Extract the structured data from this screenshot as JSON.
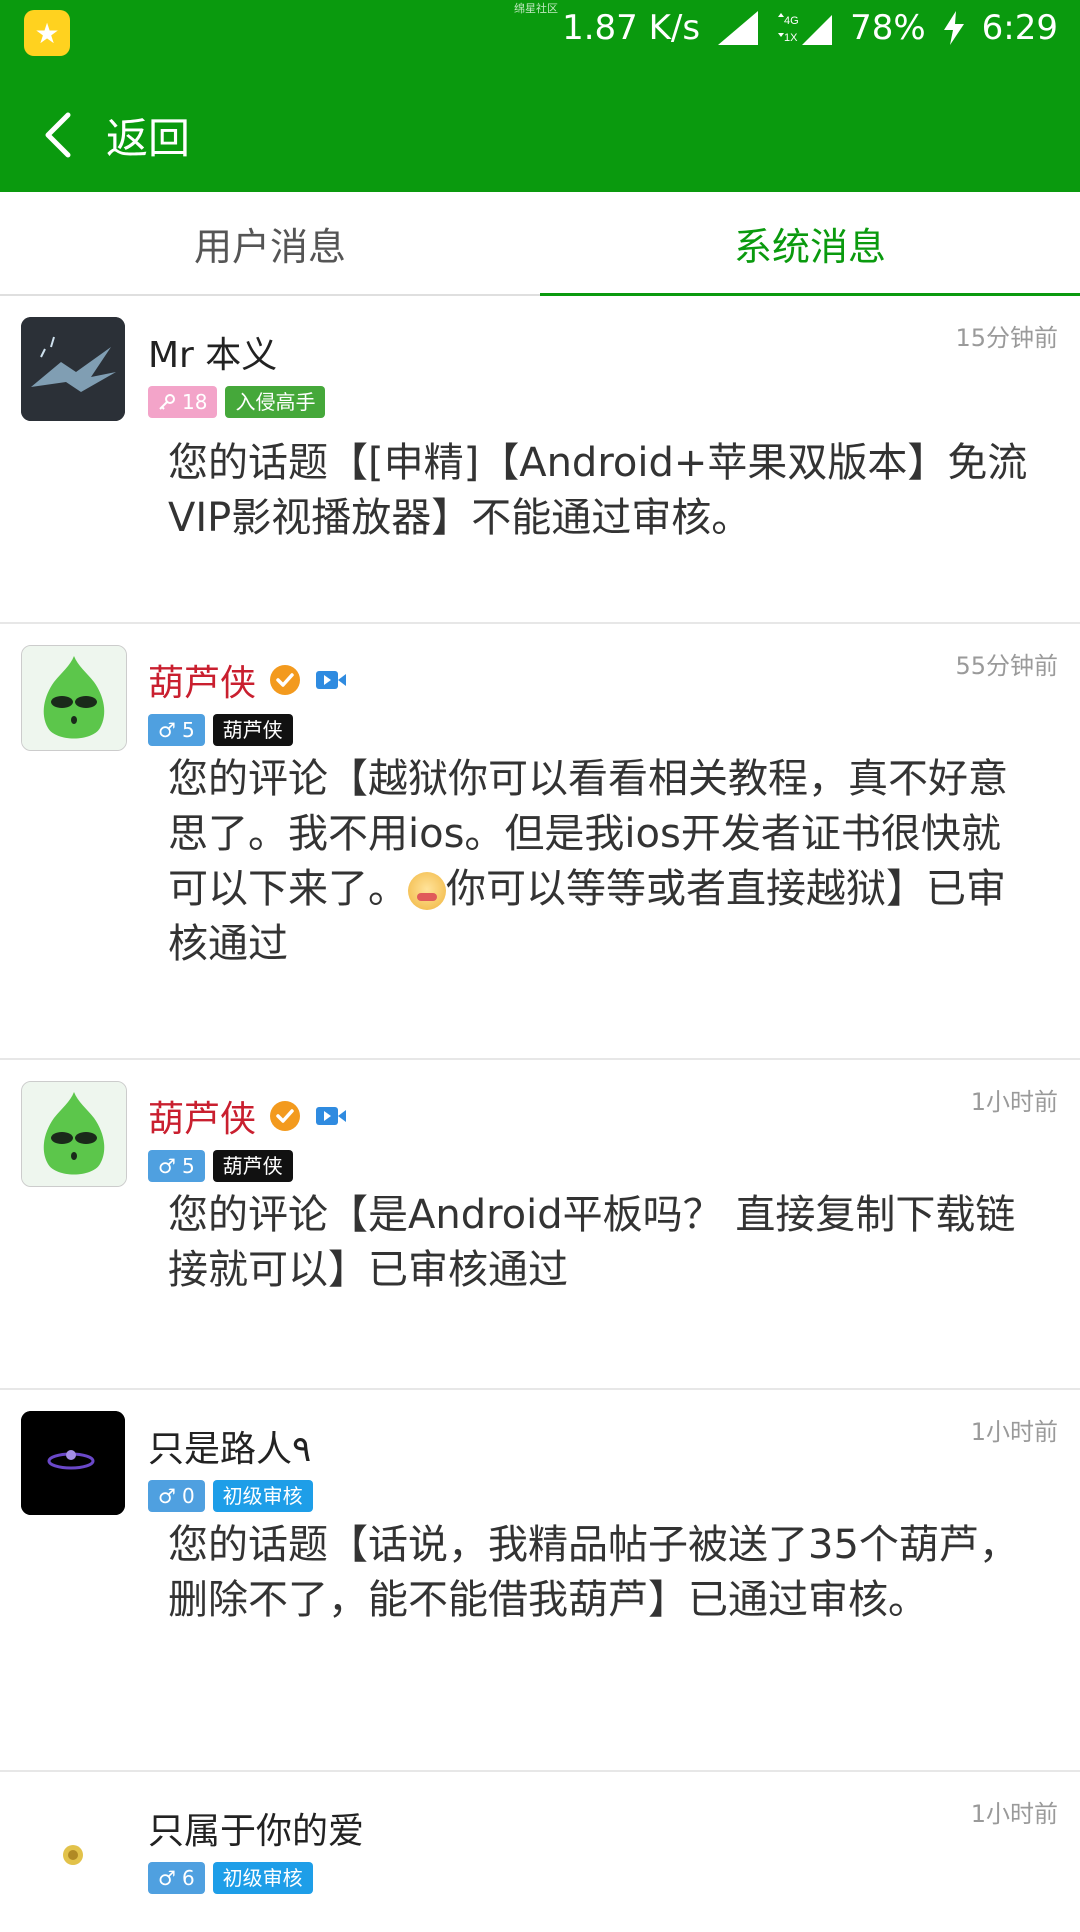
{
  "status": {
    "top_tiny_text": "绵星社区",
    "speed": "1.87 K/s",
    "network": "4G 1X",
    "battery": "78%",
    "time": "6:29"
  },
  "nav": {
    "back_label": "返回"
  },
  "tabs": [
    {
      "label": "用户消息",
      "active": false
    },
    {
      "label": "系统消息",
      "active": true
    }
  ],
  "colors": {
    "brand_green": "#0a9a0e",
    "username_red": "#c91f2f"
  },
  "messages": [
    {
      "username": "Mr 本义",
      "username_color": "normal",
      "time": "15分钟前",
      "badges": [
        {
          "text": "18",
          "kind": "key-pink"
        },
        {
          "text": "入侵高手",
          "kind": "green"
        }
      ],
      "content": "您的话题【[申精]【Android+苹果双版本】免流VIP影视播放器】不能通过审核。"
    },
    {
      "username": "葫芦侠",
      "username_color": "red",
      "time": "55分钟前",
      "badges": [
        {
          "text": "5",
          "kind": "male-blue"
        },
        {
          "text": "葫芦侠",
          "kind": "black"
        }
      ],
      "content_before_emoji": "您的评论【越狱你可以看看相关教程，真不好意思了。我不用ios。但是我ios开发者证书很快就可以下来了。",
      "content_after_emoji": "你可以等等或者直接越狱】已审核通过"
    },
    {
      "username": "葫芦侠",
      "username_color": "red",
      "time": "1小时前",
      "badges": [
        {
          "text": "5",
          "kind": "male-blue"
        },
        {
          "text": "葫芦侠",
          "kind": "black"
        }
      ],
      "content": "您的评论【是Android平板吗？ 直接复制下载链接就可以】已审核通过"
    },
    {
      "username": "只是路人٩",
      "username_color": "normal",
      "time": "1小时前",
      "badges": [
        {
          "text": "0",
          "kind": "male-blue"
        },
        {
          "text": "初级审核",
          "kind": "cyan"
        }
      ],
      "content": "您的话题【话说，我精品帖子被送了35个葫芦，删除不了，能不能借我葫芦】已通过审核。"
    },
    {
      "username": "只属于你的爱",
      "username_color": "normal",
      "time": "1小时前",
      "badges": [
        {
          "text": "6",
          "kind": "male-blue"
        },
        {
          "text": "初级审核",
          "kind": "cyan"
        }
      ]
    }
  ]
}
